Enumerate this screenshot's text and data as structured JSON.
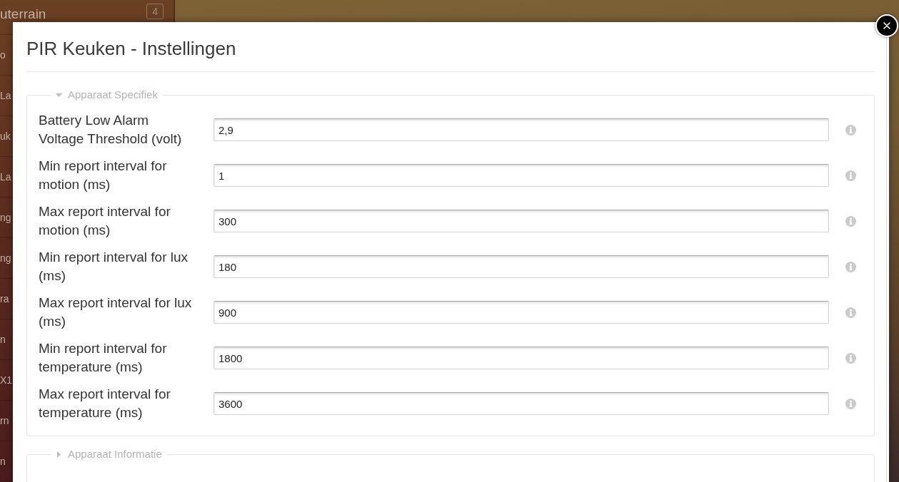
{
  "sidebar": {
    "items": [
      {
        "label": "uterrain",
        "badge": "4"
      },
      {
        "label": "o"
      },
      {
        "label": "La"
      },
      {
        "label": "uk"
      },
      {
        "label": "La"
      },
      {
        "label": "ng"
      },
      {
        "label": "ng"
      },
      {
        "label": "ra"
      },
      {
        "label": "n"
      },
      {
        "label": "X1"
      },
      {
        "label": "rn"
      },
      {
        "label": "n"
      }
    ]
  },
  "dialog": {
    "title": "PIR Keuken - Instellingen",
    "sections": [
      {
        "title": "Apparaat Specifiek",
        "expanded": true,
        "fields": [
          {
            "label": "Battery Low Alarm Voltage Threshold (volt)",
            "value": "2,9"
          },
          {
            "label": "Min report interval for motion (ms)",
            "value": "1"
          },
          {
            "label": "Max report interval for motion (ms)",
            "value": "300"
          },
          {
            "label": "Min report interval for lux (ms)",
            "value": "180"
          },
          {
            "label": "Max report interval for lux (ms)",
            "value": "900"
          },
          {
            "label": "Min report interval for temperature (ms)",
            "value": "1800"
          },
          {
            "label": "Max report interval for temperature (ms)",
            "value": "3600"
          }
        ]
      },
      {
        "title": "Apparaat Informatie",
        "expanded": false
      }
    ]
  }
}
